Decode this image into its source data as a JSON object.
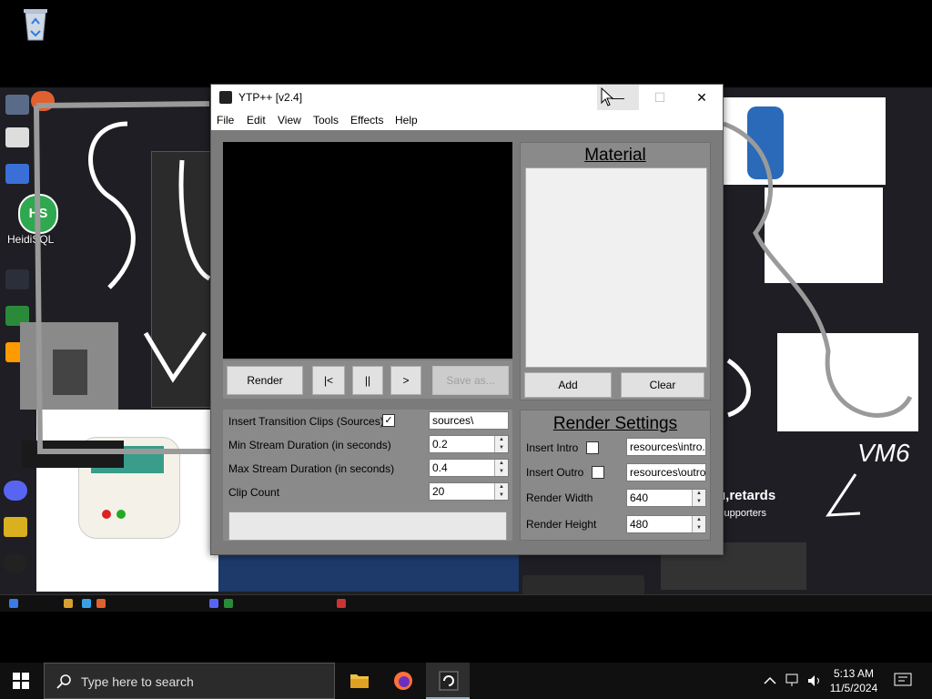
{
  "desktop": {
    "recycle_bin_label": "Recycle Bin"
  },
  "background_vm": {
    "icons": [
      {
        "label": "HeidiSQL"
      }
    ],
    "scribble_text": "VM6",
    "meme_text_1": "u,retards",
    "meme_text_2": "supporters"
  },
  "window": {
    "title": "YTP++ [v2.4]",
    "minimize_glyph": "—",
    "maximize_glyph": "☐",
    "close_glyph": "✕"
  },
  "menu": {
    "items": [
      "File",
      "Edit",
      "View",
      "Tools",
      "Effects",
      "Help"
    ]
  },
  "controls": {
    "render_label": "Render",
    "prev_label": "|<",
    "pause_label": "||",
    "next_label": ">",
    "save_as_label": "Save as..."
  },
  "material": {
    "title": "Material",
    "add_label": "Add",
    "clear_label": "Clear"
  },
  "settings": {
    "insert_transition_label": "Insert Transition Clips (Sources)",
    "insert_transition_checked": "✓",
    "sources_value": "sources\\",
    "min_stream_label": "Min Stream Duration (in seconds)",
    "min_stream_value": "0.2",
    "max_stream_label": "Max Stream Duration (in seconds)",
    "max_stream_value": "0.4",
    "clip_count_label": "Clip Count",
    "clip_count_value": "20"
  },
  "render_settings": {
    "title": "Render Settings",
    "insert_intro_label": "Insert Intro",
    "intro_path": "resources\\intro.m",
    "insert_outro_label": "Insert Outro",
    "outro_path": "resources\\outro.",
    "render_width_label": "Render Width",
    "render_width_value": "640",
    "render_height_label": "Render Height",
    "render_height_value": "480"
  },
  "taskbar": {
    "search_placeholder": "Type here to search",
    "time": "5:13 AM",
    "date": "11/5/2024"
  },
  "colors": {
    "window_bg": "#7b7b7b",
    "panel_bg": "#8a8a8a",
    "taskbar_bg": "#101010"
  }
}
